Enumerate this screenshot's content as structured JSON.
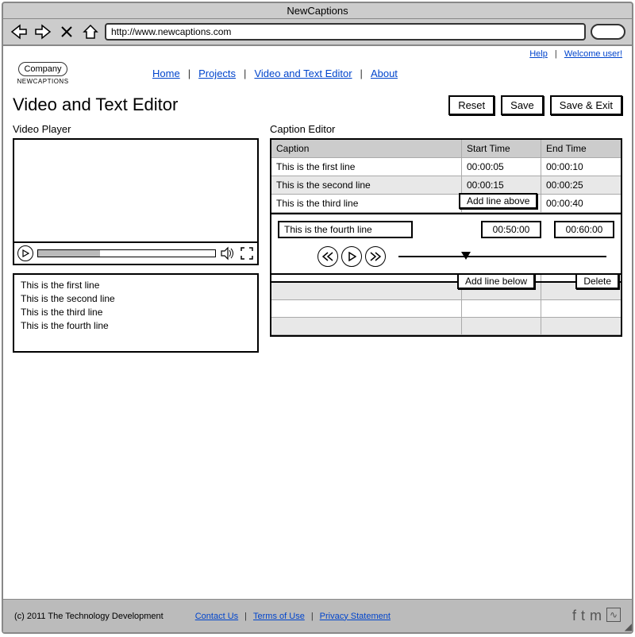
{
  "window": {
    "title": "NewCaptions",
    "url": "http://www.newcaptions.com"
  },
  "top_links": {
    "help": "Help",
    "welcome": "Welcome user!"
  },
  "logo": {
    "company": "Company",
    "sub": "NEWCAPTIONS"
  },
  "nav": {
    "home": "Home",
    "projects": "Projects",
    "editor": "Video and Text Editor",
    "about": "About"
  },
  "page": {
    "title": "Video and Text Editor"
  },
  "actions": {
    "reset": "Reset",
    "save": "Save",
    "save_exit": "Save & Exit"
  },
  "video": {
    "label": "Video Player"
  },
  "caption_editor": {
    "label": "Caption Editor",
    "headers": {
      "caption": "Caption",
      "start": "Start Time",
      "end": "End Time"
    },
    "rows": [
      {
        "caption": "This is the first line",
        "start": "00:00:05",
        "end": "00:00:10"
      },
      {
        "caption": "This is the second line",
        "start": "00:00:15",
        "end": "00:00:25"
      },
      {
        "caption": "This is the third line",
        "start": "",
        "end": "00:00:40"
      }
    ],
    "add_above": "Add line above",
    "edit": {
      "caption": "This is the fourth line",
      "start": "00:50:00",
      "end": "00:60:00"
    },
    "add_below": "Add line below",
    "delete": "Delete"
  },
  "caption_list": [
    "This is the first line",
    "This is the second line",
    "This is the third line",
    "This is the fourth line"
  ],
  "footer": {
    "copyright": "(c) 2011 The Technology Development",
    "contact": "Contact Us",
    "terms": "Terms of Use",
    "privacy": "Privacy Statement"
  }
}
